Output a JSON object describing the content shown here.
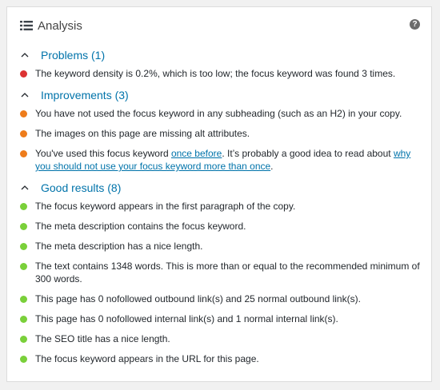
{
  "colors": {
    "red": "#dc3232",
    "orange": "#ee7c1b",
    "green": "#7ad03a",
    "link": "#0073aa"
  },
  "header": {
    "title": "Analysis",
    "icon": "list-icon",
    "help_icon": "help-icon",
    "help_glyph": "?"
  },
  "sections": [
    {
      "title": "Problems (1)",
      "items": [
        {
          "status": "red",
          "text": "The keyword density is 0.2%, which is too low; the focus keyword was found 3 times."
        }
      ]
    },
    {
      "title": "Improvements (3)",
      "items": [
        {
          "status": "orange",
          "text": "You have not used the focus keyword in any subheading (such as an H2) in your copy."
        },
        {
          "status": "orange",
          "text": "The images on this page are missing alt attributes."
        },
        {
          "status": "orange",
          "text_before": "You've used this focus keyword ",
          "link1": "once before",
          "text_middle": ". It’s probably a good idea to read about ",
          "link2": "why you should not use your focus keyword more than once",
          "text_after": "."
        }
      ]
    },
    {
      "title": "Good results (8)",
      "items": [
        {
          "status": "green",
          "text": "The focus keyword appears in the first paragraph of the copy."
        },
        {
          "status": "green",
          "text": "The meta description contains the focus keyword."
        },
        {
          "status": "green",
          "text": "The meta description has a nice length."
        },
        {
          "status": "green",
          "text": "The text contains 1348 words. This is more than or equal to the recommended minimum of 300 words."
        },
        {
          "status": "green",
          "text": "This page has 0 nofollowed outbound link(s) and 25 normal outbound link(s)."
        },
        {
          "status": "green",
          "text": "This page has 0 nofollowed internal link(s) and 1 normal internal link(s)."
        },
        {
          "status": "green",
          "text": "The SEO title has a nice length."
        },
        {
          "status": "green",
          "text": "The focus keyword appears in the URL for this page."
        }
      ]
    }
  ]
}
